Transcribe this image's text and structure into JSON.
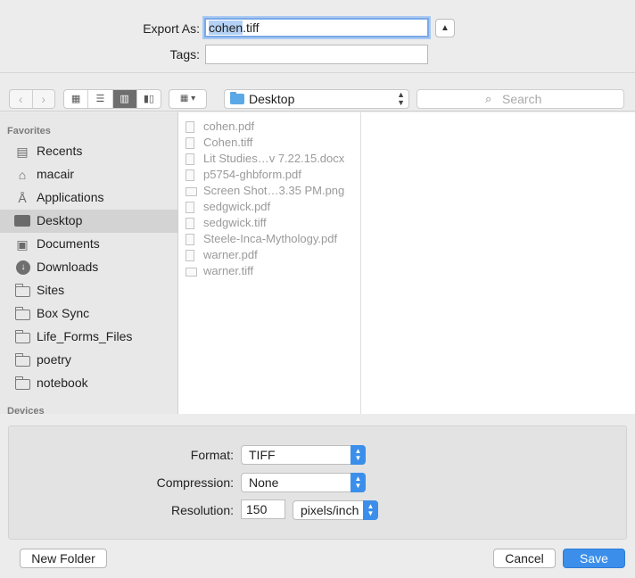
{
  "header": {
    "export_label": "Export As:",
    "export_value_selected": "cohen",
    "export_value_rest": ".tiff",
    "tags_label": "Tags:",
    "tags_value": ""
  },
  "toolbar": {
    "back_glyph": "‹",
    "forward_glyph": "›",
    "location": "Desktop",
    "search_placeholder": "Search"
  },
  "sidebar": {
    "favorites_heading": "Favorites",
    "items": [
      {
        "label": "Recents",
        "icon": "recents-icon"
      },
      {
        "label": "macair",
        "icon": "home-icon"
      },
      {
        "label": "Applications",
        "icon": "applications-icon"
      },
      {
        "label": "Desktop",
        "icon": "desktop-icon"
      },
      {
        "label": "Documents",
        "icon": "documents-icon"
      },
      {
        "label": "Downloads",
        "icon": "downloads-icon"
      },
      {
        "label": "Sites",
        "icon": "folder-icon"
      },
      {
        "label": "Box Sync",
        "icon": "folder-icon"
      },
      {
        "label": "Life_Forms_Files",
        "icon": "folder-icon"
      },
      {
        "label": "poetry",
        "icon": "folder-icon"
      },
      {
        "label": "notebook",
        "icon": "folder-icon"
      }
    ],
    "devices_heading": "Devices"
  },
  "files": [
    "cohen.pdf",
    "Cohen.tiff",
    "Lit Studies…v 7.22.15.docx",
    "p5754-ghbform.pdf",
    "Screen Shot…3.35 PM.png",
    "sedgwick.pdf",
    "sedgwick.tiff",
    "Steele-Inca-Mythology.pdf",
    "warner.pdf",
    "warner.tiff"
  ],
  "options": {
    "format_label": "Format:",
    "format_value": "TIFF",
    "compression_label": "Compression:",
    "compression_value": "None",
    "resolution_label": "Resolution:",
    "resolution_value": "150",
    "resolution_unit": "pixels/inch"
  },
  "buttons": {
    "new_folder": "New Folder",
    "cancel": "Cancel",
    "save": "Save"
  }
}
